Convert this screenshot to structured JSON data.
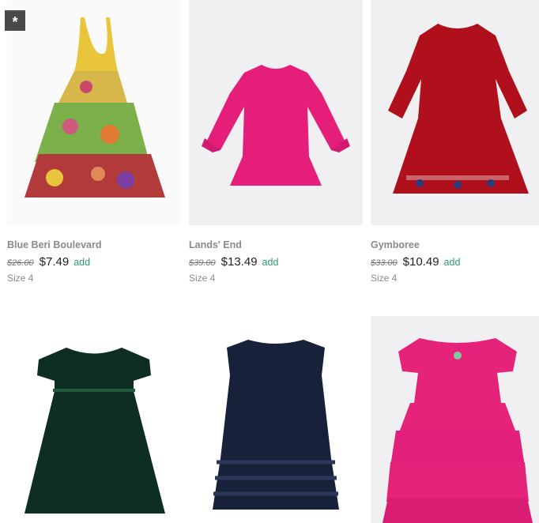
{
  "badge": {
    "symbol": "*",
    "icon": "star-badge-icon"
  },
  "products": [
    {
      "brand": "Blue Beri Boulevard",
      "original_price": "$26.00",
      "price": "$7.49",
      "add_label": "add",
      "size": "Size 4",
      "image": "multicolor-paisley-tiered-halter-dress"
    },
    {
      "brand": "Lands' End",
      "original_price": "$39.00",
      "price": "$13.49",
      "add_label": "add",
      "size": "Size 4",
      "image": "pink-polka-dot-ruffle-dress"
    },
    {
      "brand": "Gymboree",
      "original_price": "$33.00",
      "price": "$10.49",
      "add_label": "add",
      "size": "Size 4",
      "image": "red-velvet-dress"
    },
    {
      "image": "green-velvet-dress"
    },
    {
      "image": "navy-tiered-ruffle-dress"
    },
    {
      "image": "pink-polka-dot-tiered-ruffle-dress"
    }
  ],
  "colors": {
    "accent_add": "#2e9a6a",
    "tile_background": "#f0f0f2"
  }
}
